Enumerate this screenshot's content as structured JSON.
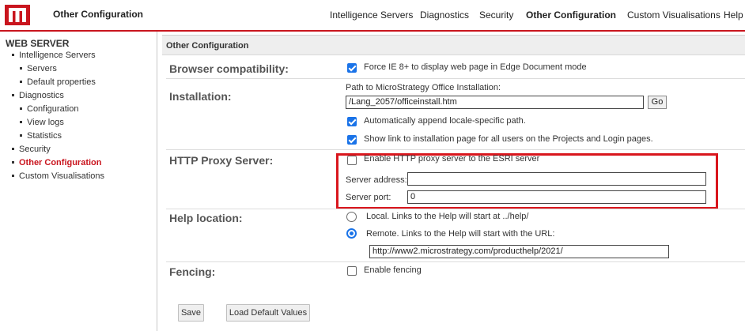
{
  "header": {
    "app_title": "Other Configuration",
    "nav": [
      {
        "label": "Intelligence Servers"
      },
      {
        "label": "Diagnostics"
      },
      {
        "label": "Security"
      },
      {
        "label": "Other Configuration",
        "active": true
      },
      {
        "label": "Custom Visualisations"
      },
      {
        "label": "Help"
      }
    ],
    "accent_color": "#c9151e"
  },
  "sidebar": {
    "heading": "WEB SERVER",
    "items": [
      {
        "label": "Intelligence Servers",
        "level": 1
      },
      {
        "label": "Servers",
        "level": 2
      },
      {
        "label": "Default properties",
        "level": 2
      },
      {
        "label": "Diagnostics",
        "level": 1
      },
      {
        "label": "Configuration",
        "level": 2
      },
      {
        "label": "View logs",
        "level": 2
      },
      {
        "label": "Statistics",
        "level": 2
      },
      {
        "label": "Security",
        "level": 1
      },
      {
        "label": "Other Configuration",
        "level": 1,
        "active": true
      },
      {
        "label": "Custom Visualisations",
        "level": 1
      }
    ]
  },
  "main": {
    "panel_title": "Other Configuration",
    "browser": {
      "label": "Browser compatibility:",
      "force_ie_label": "Force IE 8+ to display web page in Edge Document mode",
      "force_ie_checked": true
    },
    "installation": {
      "label": "Installation:",
      "path_label": "Path to MicroStrategy Office Installation:",
      "path_value": "/Lang_2057/officeinstall.htm",
      "go_label": "Go",
      "append_locale_label": "Automatically append locale-specific path.",
      "append_locale_checked": true,
      "show_link_label": "Show link to installation page for all users on the Projects and Login pages.",
      "show_link_checked": true
    },
    "proxy": {
      "label": "HTTP Proxy Server:",
      "enable_label": "Enable HTTP proxy server to the ESRI server",
      "enable_checked": false,
      "address_label": "Server address:",
      "address_value": "",
      "port_label": "Server port:",
      "port_value": "0"
    },
    "help": {
      "label": "Help location:",
      "local_label": "Local. Links to the Help will start at ../help/",
      "remote_label": "Remote. Links to the Help will start with the URL:",
      "selected": "remote",
      "url_value": "http://www2.microstrategy.com/producthelp/2021/"
    },
    "fencing": {
      "label": "Fencing:",
      "enable_label": "Enable fencing",
      "enable_checked": false
    },
    "buttons": {
      "save_label": "Save",
      "load_defaults_label": "Load Default Values"
    }
  }
}
